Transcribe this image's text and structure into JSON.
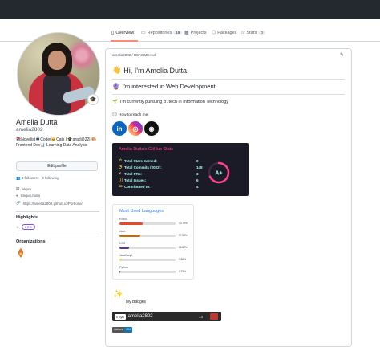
{
  "tabs": [
    {
      "label": "Overview",
      "icon": "book-open-icon"
    },
    {
      "label": "Repositories",
      "icon": "repo-icon",
      "count": "19"
    },
    {
      "label": "Projects",
      "icon": "table-icon"
    },
    {
      "label": "Packages",
      "icon": "package-icon"
    },
    {
      "label": "Stars",
      "icon": "star-icon",
      "count": "0"
    }
  ],
  "profile": {
    "name": "Amelia Dutta",
    "login": "amelia2802",
    "status_emoji": "🎓",
    "bio": "📚Novelist💻Coder🐱Cats | 🎓grad@22| 🎨Frontend Dev📊 Learning Data Analysis",
    "edit_label": "Edit profile",
    "followers_text": "4 followers · 9 following",
    "company": "Akpro",
    "location": "Siliguri,India",
    "website": "https://amelia2802.github.io/Portfolio/"
  },
  "highlights": {
    "heading": "Highlights",
    "pro_label": "PRO"
  },
  "organizations": {
    "heading": "Organizations"
  },
  "readme": {
    "path": "amelia2802 / README.md",
    "greeting": "Hi, I'm Amelia Dutta",
    "interest": "I'm interested in Web Development",
    "pursuing": "I'm currently pursuing B. tech in Information Technology",
    "reach": "How to reach me:",
    "socials": [
      {
        "name": "linkedin",
        "glyph": "in",
        "color": "#0a66c2"
      },
      {
        "name": "instagram",
        "glyph": "◎",
        "color": "#d6249f"
      },
      {
        "name": "dev",
        "glyph": "◉",
        "color": "#111111"
      }
    ],
    "stats": {
      "title": "Amelia Dutta's GitHub Stats",
      "rows": [
        {
          "label": "Total Stars Earned:",
          "value": "0"
        },
        {
          "label": "Total Commits (2022):",
          "value": "148"
        },
        {
          "label": "Total PRs:",
          "value": "3"
        },
        {
          "label": "Total Issues:",
          "value": "6"
        },
        {
          "label": "Contributed to:",
          "value": "4"
        }
      ],
      "grade": "A+",
      "grade_fraction": 0.68
    },
    "languages": {
      "title": "Most Used Languages",
      "items": [
        {
          "name": "HTML",
          "pct_label": "40.79%",
          "pct": 40.79,
          "color": "#e34c26"
        },
        {
          "name": "Java",
          "pct_label": "37.58%",
          "pct": 37.58,
          "color": "#b07219"
        },
        {
          "name": "CSS",
          "pct_label": "16.82%",
          "pct": 16.82,
          "color": "#563d7c"
        },
        {
          "name": "JavaScript",
          "pct_label": "3.88%",
          "pct": 3.88,
          "color": "#f1e05a"
        },
        {
          "name": "Python",
          "pct_label": "0.73%",
          "pct": 0.73,
          "color": "#3572a5"
        }
      ]
    },
    "badges_label": "My Badges",
    "tryhackme": {
      "tag": "0 kyu",
      "user": "amelia2802",
      "number": "13"
    },
    "visitors": {
      "label": "visitors",
      "count": "404"
    }
  }
}
